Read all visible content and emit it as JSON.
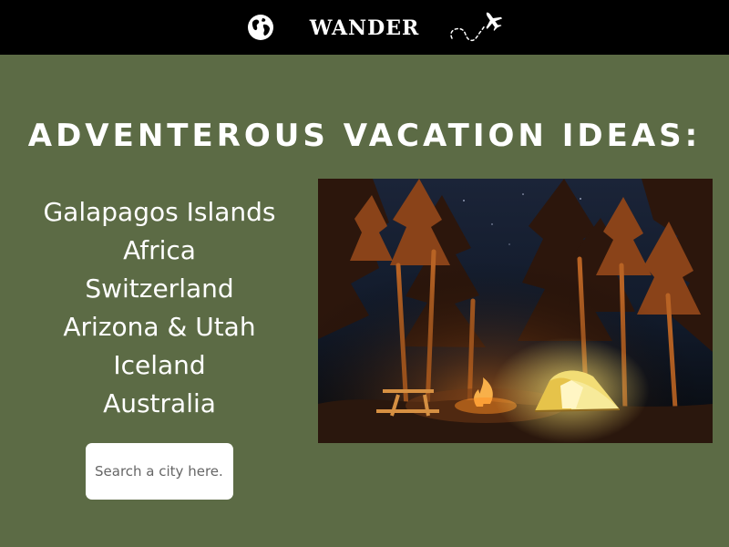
{
  "header": {
    "brand": "WANDER",
    "left_icon": "globe-icon",
    "right_icon": "airplane-icon"
  },
  "main": {
    "headline": "ADVENTEROUS VACATION IDEAS:",
    "destinations": [
      "Galapagos Islands",
      "Africa",
      "Switzerland",
      "Arizona & Utah",
      "Iceland",
      "Australia"
    ],
    "search": {
      "placeholder": "Search a city here.."
    },
    "photo": {
      "subject": "night-campsite-photo"
    }
  },
  "colors": {
    "header_bg": "#000000",
    "page_bg": "#5c6b45",
    "text": "#ffffff",
    "search_bg": "#ffffff"
  }
}
